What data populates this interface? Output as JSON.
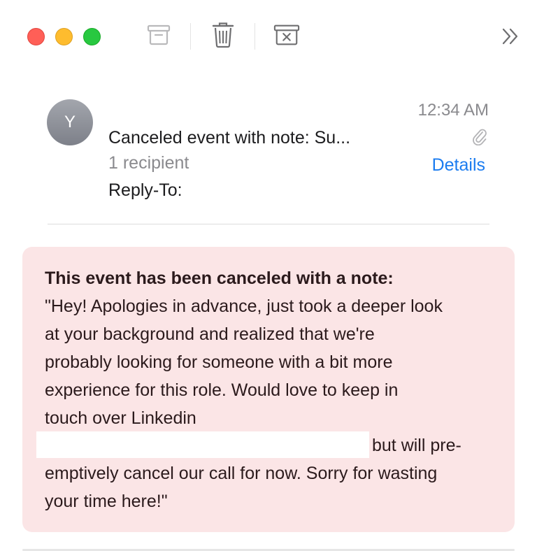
{
  "toolbar": {
    "buttons": [
      {
        "name": "archive",
        "icon": "archive-icon"
      },
      {
        "name": "trash",
        "icon": "trash-icon"
      },
      {
        "name": "junk",
        "icon": "junk-icon"
      }
    ],
    "more_icon": "chevron-double-right-icon",
    "colors": {
      "close": "#ff5f57",
      "minimize": "#febc2e",
      "zoom": "#28c840"
    }
  },
  "message": {
    "avatar_initial": "Y",
    "time": "12:34 AM",
    "subject": "Canceled event with note: Su...",
    "recipients": "1 recipient",
    "details_label": "Details",
    "reply_to": "Reply-To:",
    "attachment_icon": "paperclip-icon"
  },
  "note": {
    "title": "This event has been canceled with a note:",
    "body_lines": [
      "\"Hey! Apologies in advance, just took a deeper look",
      "at your background and realized that we're",
      "probably looking for someone with a bit more",
      "experience for this role. Would love to keep in",
      "touch over Linkedin"
    ],
    "after_redaction": "but will pre-",
    "closing_lines": [
      "emptively cancel our call for now. Sorry for wasting",
      "your time here!\""
    ],
    "background_color": "#fbe5e6"
  },
  "accent_color": "#1b7cf0"
}
